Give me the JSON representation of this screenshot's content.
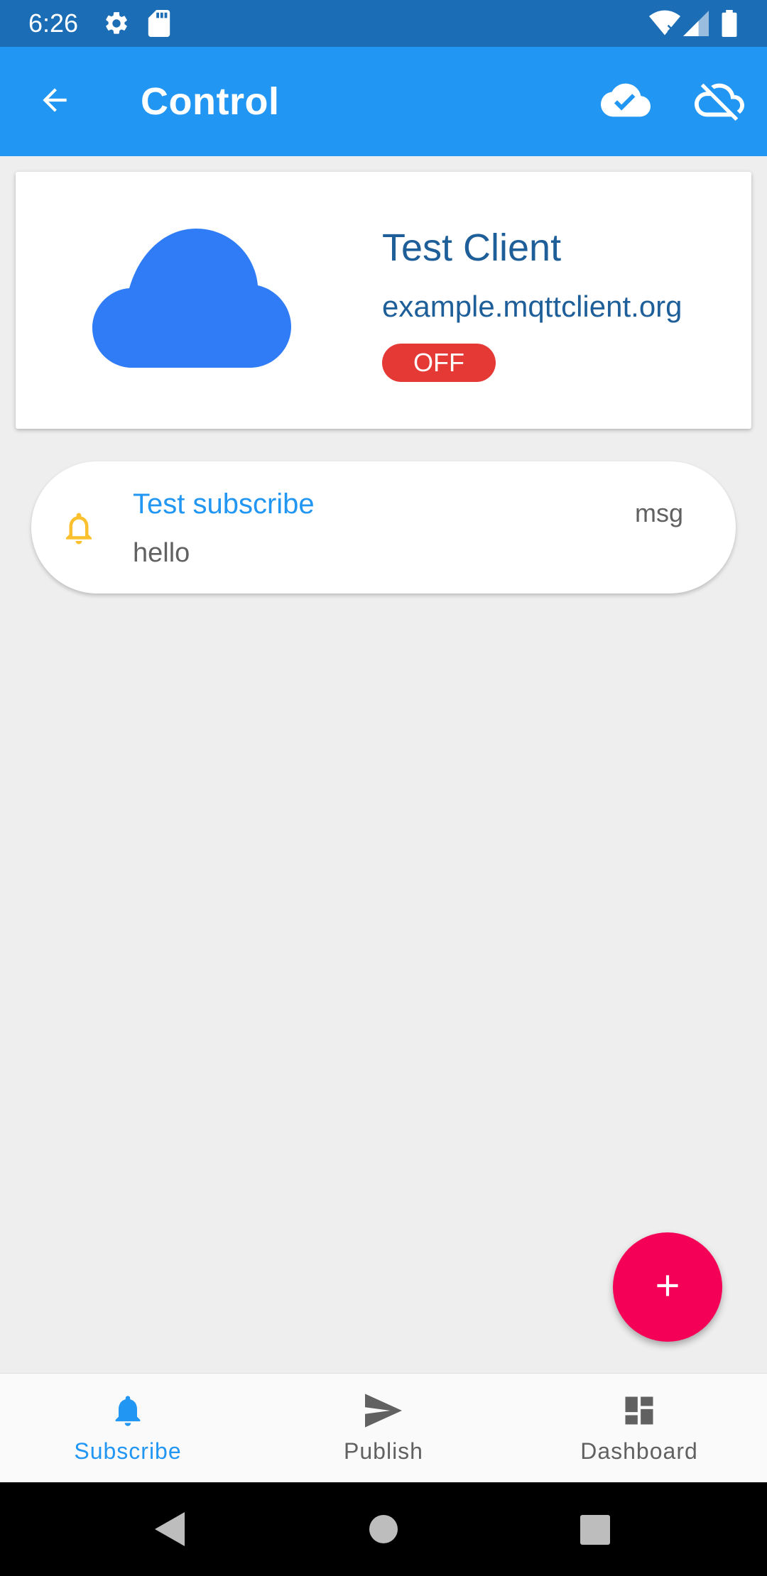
{
  "status_bar": {
    "time": "6:26",
    "left_icons": [
      "settings-icon",
      "sd-card-icon"
    ],
    "right_icons": [
      "wifi-icon",
      "signal-icon",
      "battery-icon"
    ]
  },
  "app_bar": {
    "title": "Control",
    "back_icon": "arrow-back-icon",
    "actions": [
      "cloud-done-icon",
      "cloud-off-icon"
    ],
    "color": "#2196f3"
  },
  "client": {
    "name": "Test Client",
    "host": "example.mqttclient.org",
    "status": "OFF",
    "status_color": "#e53935",
    "icon": "cloud-icon",
    "icon_color": "#2f7cf6"
  },
  "subscriptions": [
    {
      "topic": "Test subscribe",
      "message": "hello",
      "tag": "msg",
      "icon": "bell-outline-icon",
      "icon_color": "#fbc02d"
    }
  ],
  "fab": {
    "icon": "plus-icon",
    "color": "#f50057"
  },
  "bottom_nav": {
    "items": [
      {
        "label": "Subscribe",
        "icon": "bell-icon",
        "active": true
      },
      {
        "label": "Publish",
        "icon": "send-icon",
        "active": false
      },
      {
        "label": "Dashboard",
        "icon": "dashboard-icon",
        "active": false
      }
    ],
    "active_color": "#2196f3"
  },
  "system_nav": {
    "icons": [
      "back-triangle-icon",
      "home-circle-icon",
      "recents-square-icon"
    ]
  }
}
